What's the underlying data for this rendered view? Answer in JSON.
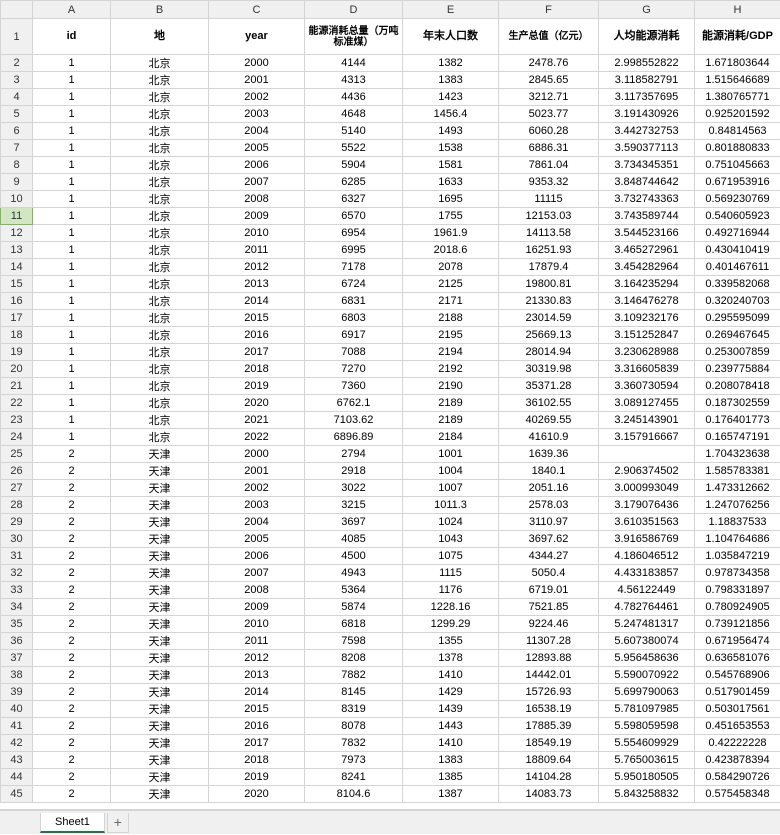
{
  "columns_letters": [
    "A",
    "B",
    "C",
    "D",
    "E",
    "F",
    "G",
    "H"
  ],
  "selected_row_number": 11,
  "headers": {
    "A": "id",
    "B": "地",
    "C": "year",
    "D": "能源消耗总量（万吨标准煤）",
    "E": "年末人口数",
    "F": "生产总值（亿元）",
    "G": "人均能源消耗",
    "H": "能源消耗/GDP"
  },
  "rows": [
    {
      "rn": 2,
      "A": "1",
      "B": "北京",
      "C": "2000",
      "D": "4144",
      "E": "1382",
      "F": "2478.76",
      "G": "2.998552822",
      "H": "1.671803644"
    },
    {
      "rn": 3,
      "A": "1",
      "B": "北京",
      "C": "2001",
      "D": "4313",
      "E": "1383",
      "F": "2845.65",
      "G": "3.118582791",
      "H": "1.515646689"
    },
    {
      "rn": 4,
      "A": "1",
      "B": "北京",
      "C": "2002",
      "D": "4436",
      "E": "1423",
      "F": "3212.71",
      "G": "3.117357695",
      "H": "1.380765771"
    },
    {
      "rn": 5,
      "A": "1",
      "B": "北京",
      "C": "2003",
      "D": "4648",
      "E": "1456.4",
      "F": "5023.77",
      "G": "3.191430926",
      "H": "0.925201592"
    },
    {
      "rn": 6,
      "A": "1",
      "B": "北京",
      "C": "2004",
      "D": "5140",
      "E": "1493",
      "F": "6060.28",
      "G": "3.442732753",
      "H": "0.84814563"
    },
    {
      "rn": 7,
      "A": "1",
      "B": "北京",
      "C": "2005",
      "D": "5522",
      "E": "1538",
      "F": "6886.31",
      "G": "3.590377113",
      "H": "0.801880833"
    },
    {
      "rn": 8,
      "A": "1",
      "B": "北京",
      "C": "2006",
      "D": "5904",
      "E": "1581",
      "F": "7861.04",
      "G": "3.734345351",
      "H": "0.751045663"
    },
    {
      "rn": 9,
      "A": "1",
      "B": "北京",
      "C": "2007",
      "D": "6285",
      "E": "1633",
      "F": "9353.32",
      "G": "3.848744642",
      "H": "0.671953916"
    },
    {
      "rn": 10,
      "A": "1",
      "B": "北京",
      "C": "2008",
      "D": "6327",
      "E": "1695",
      "F": "11115",
      "G": "3.732743363",
      "H": "0.569230769"
    },
    {
      "rn": 11,
      "A": "1",
      "B": "北京",
      "C": "2009",
      "D": "6570",
      "E": "1755",
      "F": "12153.03",
      "G": "3.743589744",
      "H": "0.540605923"
    },
    {
      "rn": 12,
      "A": "1",
      "B": "北京",
      "C": "2010",
      "D": "6954",
      "E": "1961.9",
      "F": "14113.58",
      "G": "3.544523166",
      "H": "0.492716944"
    },
    {
      "rn": 13,
      "A": "1",
      "B": "北京",
      "C": "2011",
      "D": "6995",
      "E": "2018.6",
      "F": "16251.93",
      "G": "3.465272961",
      "H": "0.430410419"
    },
    {
      "rn": 14,
      "A": "1",
      "B": "北京",
      "C": "2012",
      "D": "7178",
      "E": "2078",
      "F": "17879.4",
      "G": "3.454282964",
      "H": "0.401467611"
    },
    {
      "rn": 15,
      "A": "1",
      "B": "北京",
      "C": "2013",
      "D": "6724",
      "E": "2125",
      "F": "19800.81",
      "G": "3.164235294",
      "H": "0.339582068"
    },
    {
      "rn": 16,
      "A": "1",
      "B": "北京",
      "C": "2014",
      "D": "6831",
      "E": "2171",
      "F": "21330.83",
      "G": "3.146476278",
      "H": "0.320240703"
    },
    {
      "rn": 17,
      "A": "1",
      "B": "北京",
      "C": "2015",
      "D": "6803",
      "E": "2188",
      "F": "23014.59",
      "G": "3.109232176",
      "H": "0.295595099"
    },
    {
      "rn": 18,
      "A": "1",
      "B": "北京",
      "C": "2016",
      "D": "6917",
      "E": "2195",
      "F": "25669.13",
      "G": "3.151252847",
      "H": "0.269467645"
    },
    {
      "rn": 19,
      "A": "1",
      "B": "北京",
      "C": "2017",
      "D": "7088",
      "E": "2194",
      "F": "28014.94",
      "G": "3.230628988",
      "H": "0.253007859"
    },
    {
      "rn": 20,
      "A": "1",
      "B": "北京",
      "C": "2018",
      "D": "7270",
      "E": "2192",
      "F": "30319.98",
      "G": "3.316605839",
      "H": "0.239775884"
    },
    {
      "rn": 21,
      "A": "1",
      "B": "北京",
      "C": "2019",
      "D": "7360",
      "E": "2190",
      "F": "35371.28",
      "G": "3.360730594",
      "H": "0.208078418"
    },
    {
      "rn": 22,
      "A": "1",
      "B": "北京",
      "C": "2020",
      "D": "6762.1",
      "E": "2189",
      "F": "36102.55",
      "G": "3.089127455",
      "H": "0.187302559"
    },
    {
      "rn": 23,
      "A": "1",
      "B": "北京",
      "C": "2021",
      "D": "7103.62",
      "E": "2189",
      "F": "40269.55",
      "G": "3.245143901",
      "H": "0.176401773"
    },
    {
      "rn": 24,
      "A": "1",
      "B": "北京",
      "C": "2022",
      "D": "6896.89",
      "E": "2184",
      "F": "41610.9",
      "G": "3.157916667",
      "H": "0.165747191"
    },
    {
      "rn": 25,
      "A": "2",
      "B": "天津",
      "C": "2000",
      "D": "2794",
      "E": "1001",
      "F": "1639.36",
      "G": "",
      "H": "1.704323638"
    },
    {
      "rn": 26,
      "A": "2",
      "B": "天津",
      "C": "2001",
      "D": "2918",
      "E": "1004",
      "F": "1840.1",
      "G": "2.906374502",
      "H": "1.585783381"
    },
    {
      "rn": 27,
      "A": "2",
      "B": "天津",
      "C": "2002",
      "D": "3022",
      "E": "1007",
      "F": "2051.16",
      "G": "3.000993049",
      "H": "1.473312662"
    },
    {
      "rn": 28,
      "A": "2",
      "B": "天津",
      "C": "2003",
      "D": "3215",
      "E": "1011.3",
      "F": "2578.03",
      "G": "3.179076436",
      "H": "1.247076256"
    },
    {
      "rn": 29,
      "A": "2",
      "B": "天津",
      "C": "2004",
      "D": "3697",
      "E": "1024",
      "F": "3110.97",
      "G": "3.610351563",
      "H": "1.18837533"
    },
    {
      "rn": 30,
      "A": "2",
      "B": "天津",
      "C": "2005",
      "D": "4085",
      "E": "1043",
      "F": "3697.62",
      "G": "3.916586769",
      "H": "1.104764686"
    },
    {
      "rn": 31,
      "A": "2",
      "B": "天津",
      "C": "2006",
      "D": "4500",
      "E": "1075",
      "F": "4344.27",
      "G": "4.186046512",
      "H": "1.035847219"
    },
    {
      "rn": 32,
      "A": "2",
      "B": "天津",
      "C": "2007",
      "D": "4943",
      "E": "1115",
      "F": "5050.4",
      "G": "4.433183857",
      "H": "0.978734358"
    },
    {
      "rn": 33,
      "A": "2",
      "B": "天津",
      "C": "2008",
      "D": "5364",
      "E": "1176",
      "F": "6719.01",
      "G": "4.56122449",
      "H": "0.798331897"
    },
    {
      "rn": 34,
      "A": "2",
      "B": "天津",
      "C": "2009",
      "D": "5874",
      "E": "1228.16",
      "F": "7521.85",
      "G": "4.782764461",
      "H": "0.780924905"
    },
    {
      "rn": 35,
      "A": "2",
      "B": "天津",
      "C": "2010",
      "D": "6818",
      "E": "1299.29",
      "F": "9224.46",
      "G": "5.247481317",
      "H": "0.739121856"
    },
    {
      "rn": 36,
      "A": "2",
      "B": "天津",
      "C": "2011",
      "D": "7598",
      "E": "1355",
      "F": "11307.28",
      "G": "5.607380074",
      "H": "0.671956474"
    },
    {
      "rn": 37,
      "A": "2",
      "B": "天津",
      "C": "2012",
      "D": "8208",
      "E": "1378",
      "F": "12893.88",
      "G": "5.956458636",
      "H": "0.636581076"
    },
    {
      "rn": 38,
      "A": "2",
      "B": "天津",
      "C": "2013",
      "D": "7882",
      "E": "1410",
      "F": "14442.01",
      "G": "5.590070922",
      "H": "0.545768906"
    },
    {
      "rn": 39,
      "A": "2",
      "B": "天津",
      "C": "2014",
      "D": "8145",
      "E": "1429",
      "F": "15726.93",
      "G": "5.699790063",
      "H": "0.517901459"
    },
    {
      "rn": 40,
      "A": "2",
      "B": "天津",
      "C": "2015",
      "D": "8319",
      "E": "1439",
      "F": "16538.19",
      "G": "5.781097985",
      "H": "0.503017561"
    },
    {
      "rn": 41,
      "A": "2",
      "B": "天津",
      "C": "2016",
      "D": "8078",
      "E": "1443",
      "F": "17885.39",
      "G": "5.598059598",
      "H": "0.451653553"
    },
    {
      "rn": 42,
      "A": "2",
      "B": "天津",
      "C": "2017",
      "D": "7832",
      "E": "1410",
      "F": "18549.19",
      "G": "5.554609929",
      "H": "0.42222228"
    },
    {
      "rn": 43,
      "A": "2",
      "B": "天津",
      "C": "2018",
      "D": "7973",
      "E": "1383",
      "F": "18809.64",
      "G": "5.765003615",
      "H": "0.423878394"
    },
    {
      "rn": 44,
      "A": "2",
      "B": "天津",
      "C": "2019",
      "D": "8241",
      "E": "1385",
      "F": "14104.28",
      "G": "5.950180505",
      "H": "0.584290726"
    },
    {
      "rn": 45,
      "A": "2",
      "B": "天津",
      "C": "2020",
      "D": "8104.6",
      "E": "1387",
      "F": "14083.73",
      "G": "5.843258832",
      "H": "0.575458348"
    }
  ],
  "tabs": {
    "active": "Sheet1",
    "add": "+"
  }
}
